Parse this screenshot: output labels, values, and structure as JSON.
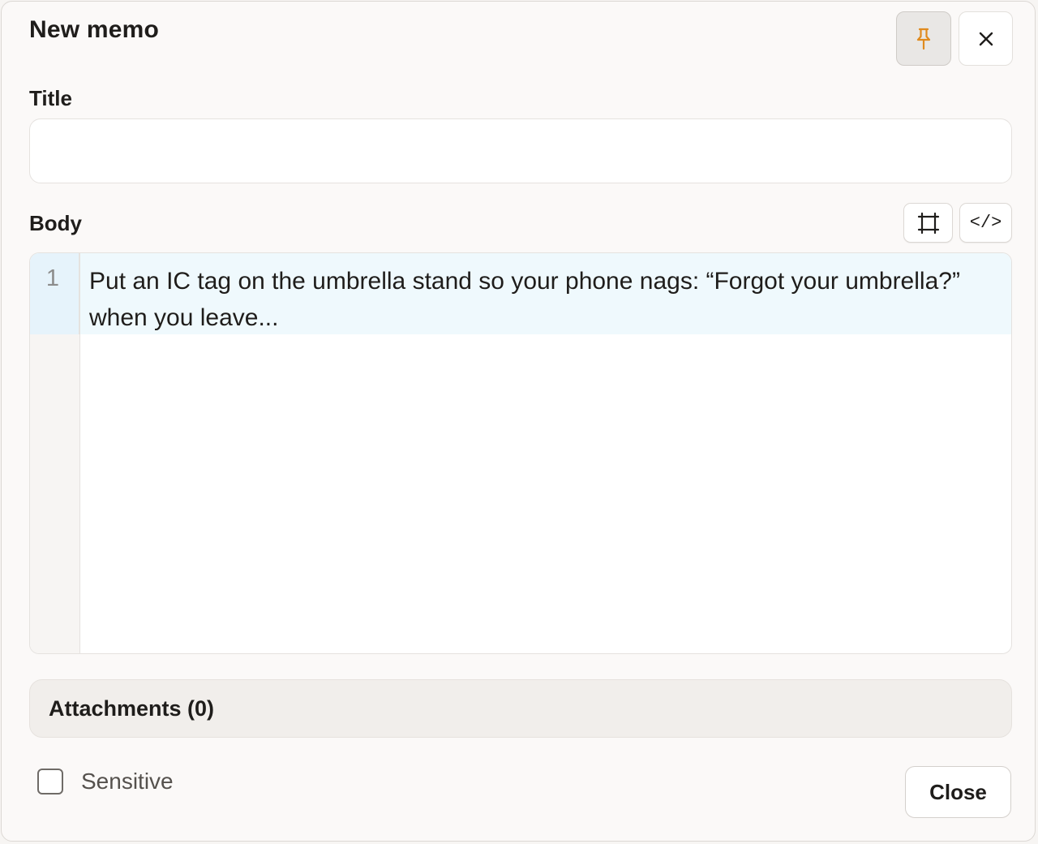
{
  "dialog": {
    "title": "New memo",
    "pin_icon": "pin-icon",
    "close_icon": "close-icon",
    "accent_color": "#e08a1e"
  },
  "form": {
    "title_label": "Title",
    "title_value": "",
    "body_label": "Body",
    "expand_icon": "expand-icon",
    "code_label": "</>",
    "line_numbers": [
      "1"
    ],
    "body_text": "Put an IC tag on the umbrella stand so your phone nags: “Forgot your umbrella?” when you leave...",
    "attachments_label": "Attachments (0)",
    "sensitive_label": "Sensitive",
    "sensitive_checked": false
  },
  "footer": {
    "close_label": "Close"
  }
}
